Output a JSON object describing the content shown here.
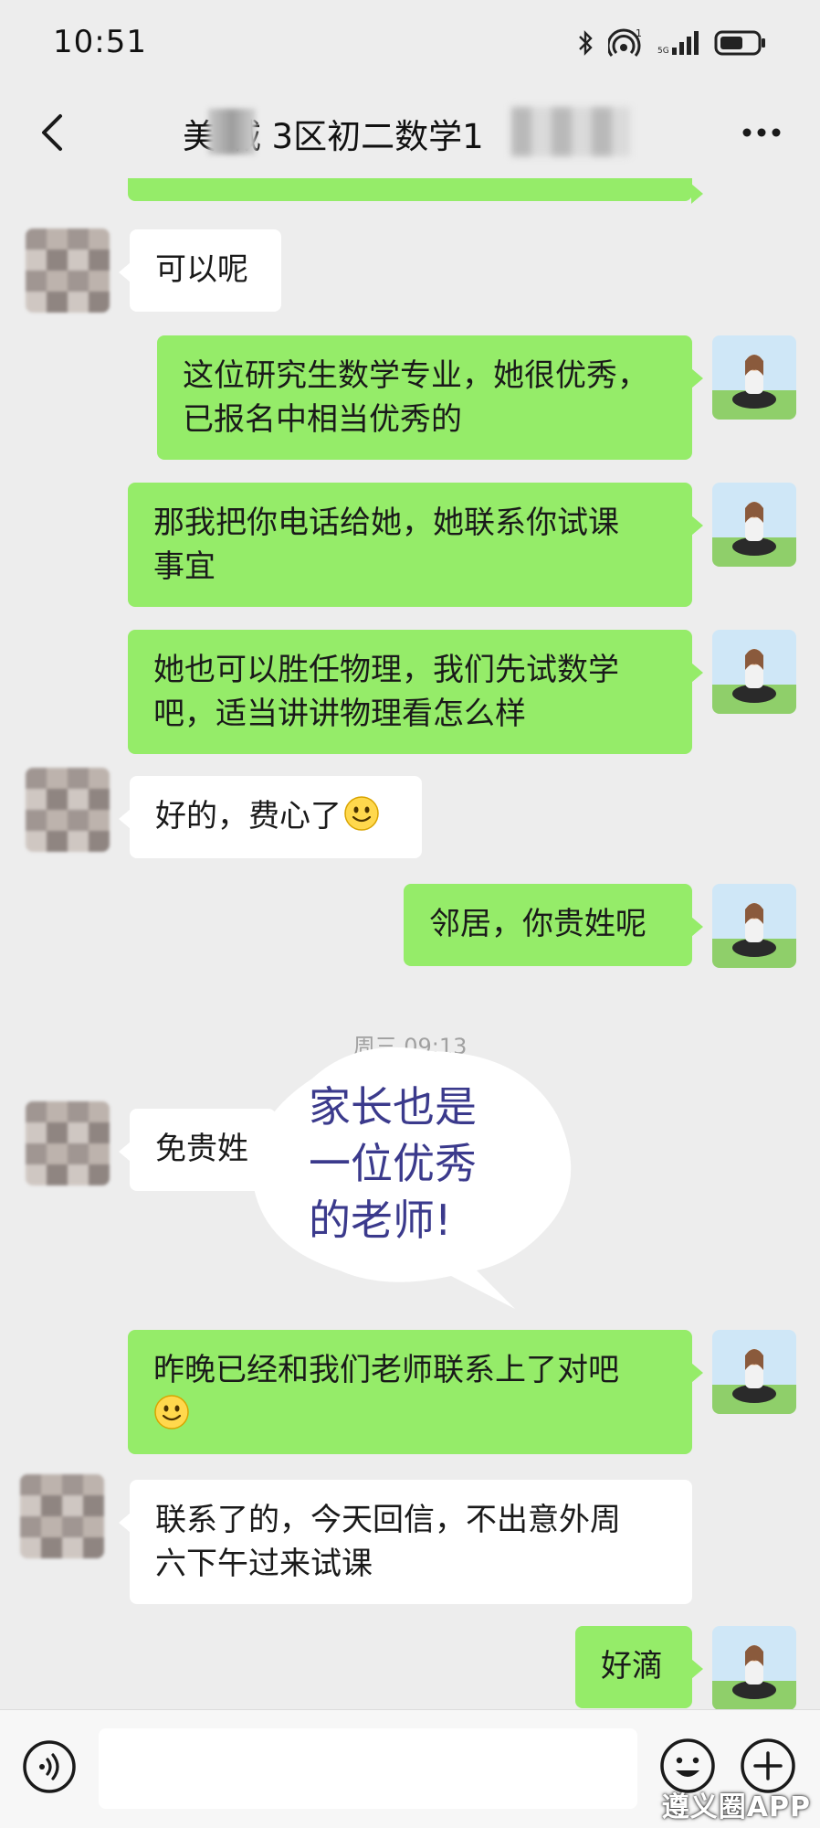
{
  "status_bar": {
    "time": "10:51",
    "icons": [
      "bluetooth-icon",
      "hotspot-icon",
      "signal-icon",
      "battery-icon"
    ]
  },
  "nav": {
    "title": "美  城  3区初二数学1",
    "back_icon": "chevron-left-icon",
    "more_icon": "more-dots-icon"
  },
  "messages": [
    {
      "side": "in",
      "text": "可以呢"
    },
    {
      "side": "out",
      "lines": [
        "这位研究生数学专业，她很优秀，",
        "已报名中相当优秀的"
      ]
    },
    {
      "side": "out",
      "lines": [
        "那我把你电话给她，她联系你试课",
        "事宜"
      ]
    },
    {
      "side": "out",
      "lines": [
        "她也可以胜任物理，我们先试数学",
        "吧，适当讲讲物理看怎么样"
      ]
    },
    {
      "side": "in",
      "text": "好的，费心了",
      "emoji": "smile-emoji"
    },
    {
      "side": "out",
      "text": "邻居，你贵姓呢"
    },
    {
      "type": "time",
      "text": "周三 09:13"
    },
    {
      "side": "in",
      "text": "免贵姓"
    },
    {
      "side": "out",
      "lines": [
        "昨晚已经和我们老师联系上了对吧"
      ],
      "emoji": "smile-emoji"
    },
    {
      "side": "in",
      "lines": [
        "联系了的，今天回信，不出意外周",
        "六下午过来试课"
      ]
    },
    {
      "side": "out",
      "text": "好滴"
    }
  ],
  "sticker": {
    "lines": [
      "家长也是",
      "一位优秀",
      "的老师!"
    ]
  },
  "input_bar": {
    "voice_icon": "voice-icon",
    "emoji_icon": "emoji-face-icon",
    "plus_icon": "plus-circle-icon"
  },
  "watermark": "遵义圈APP",
  "colors": {
    "background": "#ededed",
    "outgoing_bubble": "#95ec69",
    "incoming_bubble": "#ffffff",
    "sticker_text": "#3b3a8c"
  }
}
